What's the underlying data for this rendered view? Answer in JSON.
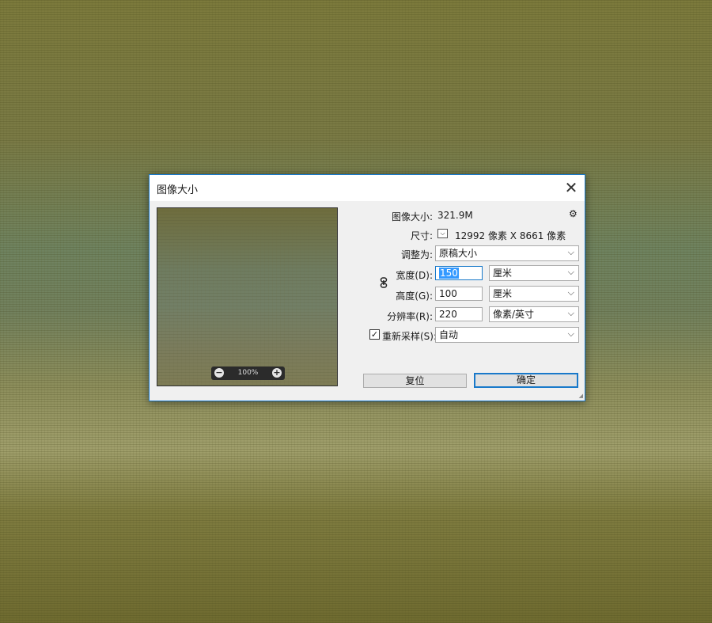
{
  "dialog": {
    "title": "图像大小",
    "close_glyph": "✕",
    "preview": {
      "zoom": "100%"
    },
    "image_size_label": "图像大小:",
    "image_size_value": "321.9M",
    "gear_glyph": "⚙",
    "dimensions_label": "尺寸:",
    "dimensions_value": "12992 像素  X  8661 像素",
    "fit_to_label": "调整为:",
    "fit_to_value": "原稿大小",
    "width_label": "宽度(D):",
    "width_value": "150",
    "width_unit": "厘米",
    "height_label": "高度(G):",
    "height_value": "100",
    "height_unit": "厘米",
    "resolution_label": "分辨率(R):",
    "resolution_value": "220",
    "resolution_unit": "像素/英寸",
    "resample_label": "重新采样(S):",
    "resample_checked": true,
    "resample_check_glyph": "✓",
    "resample_value": "自动",
    "reset_label": "复位",
    "ok_label": "确定",
    "chevron_glyph": "⌵",
    "minus_glyph": "−",
    "plus_glyph": "+"
  },
  "colors": {
    "accent": "#1979ca",
    "selection": "#3399ff"
  }
}
